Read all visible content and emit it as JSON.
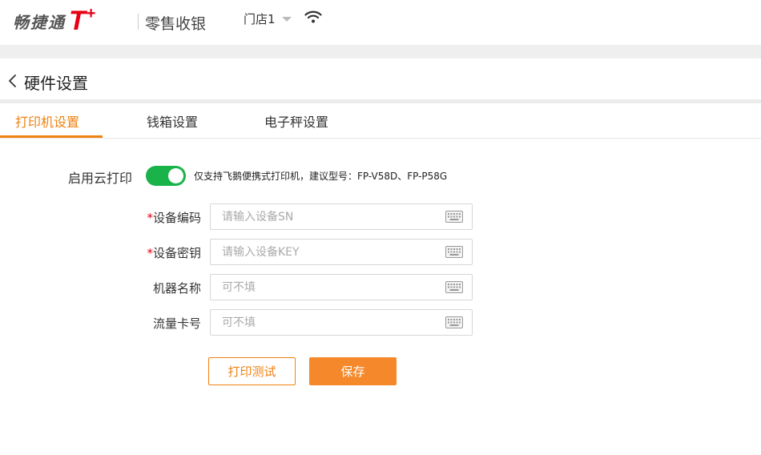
{
  "header": {
    "brand_text": "畅捷通",
    "brand_t": "T",
    "brand_plus": "+",
    "app_name": "零售收银",
    "store_label": "门店1"
  },
  "page": {
    "title": "硬件设置"
  },
  "tabs": [
    {
      "label": "打印机设置",
      "active": true
    },
    {
      "label": "钱箱设置",
      "active": false
    },
    {
      "label": "电子秤设置",
      "active": false
    }
  ],
  "cloud_print": {
    "label": "启用云打印",
    "enabled": true,
    "hint": "仅支持飞鹅便携式打印机，建议型号：FP-V58D、FP-P58G"
  },
  "form": {
    "fields": [
      {
        "label": "设备编码",
        "required": true,
        "value": "",
        "placeholder": "请输入设备SN"
      },
      {
        "label": "设备密钥",
        "required": true,
        "value": "",
        "placeholder": "请输入设备KEY"
      },
      {
        "label": "机器名称",
        "required": false,
        "value": "",
        "placeholder": "可不填"
      },
      {
        "label": "流量卡号",
        "required": false,
        "value": "",
        "placeholder": "可不填"
      }
    ],
    "required_mark": "*"
  },
  "buttons": {
    "test_label": "打印测试",
    "save_label": "保存"
  },
  "colors": {
    "accent": "#f08212",
    "brand_red": "#e60012",
    "toggle_on": "#19b34a",
    "primary_button": "#f5882a"
  },
  "icons": [
    "wifi-icon",
    "back-chevron-icon",
    "keyboard-icon",
    "dropdown-caret-icon"
  ]
}
